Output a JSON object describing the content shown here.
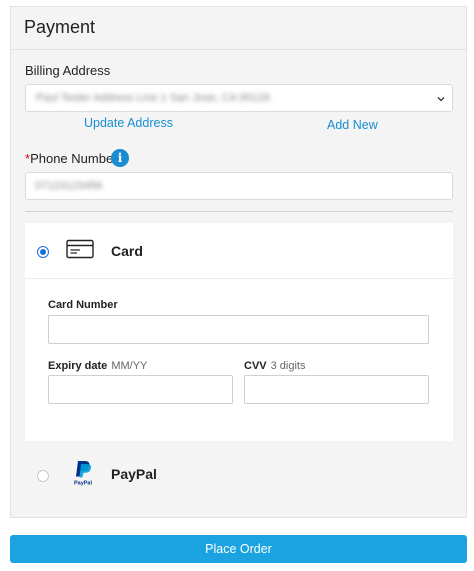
{
  "payment": {
    "title": "Payment",
    "billing_label": "Billing Address",
    "billing_value": "Paul Tester Address Line 1 San Jose, CA 95126",
    "update_address_link": "Update Address",
    "add_new_link": "Add New",
    "phone_required_mark": "*",
    "phone_label": "Phone Number",
    "phone_value": "07123123456",
    "info_icon_glyph": "i"
  },
  "methods": {
    "card": {
      "label": "Card",
      "selected": true,
      "icon": "credit-card-icon",
      "card_number_label": "Card Number",
      "card_number_value": "",
      "expiry_label": "Expiry date",
      "expiry_hint": "MM/YY",
      "expiry_value": "",
      "cvv_label": "CVV",
      "cvv_hint": "3 digits",
      "cvv_value": ""
    },
    "paypal": {
      "label": "PayPal",
      "selected": false,
      "logo_text": "PayPal",
      "icon": "paypal-logo"
    }
  },
  "actions": {
    "place_order": "Place Order"
  },
  "colors": {
    "accent": "#1aa3e0",
    "link": "#1a8ccf",
    "radio": "#1a6ed8",
    "required": "#d0021b",
    "paypal_dark": "#003087",
    "paypal_light": "#009cde"
  }
}
